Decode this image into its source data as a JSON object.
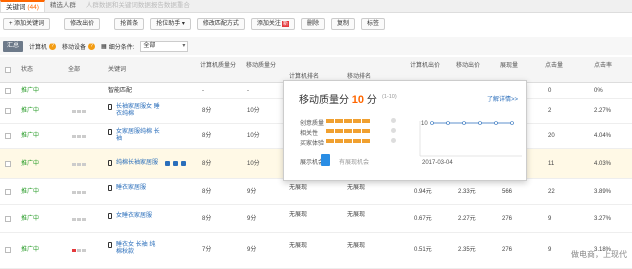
{
  "tabs": [
    {
      "label": "关键词",
      "count": "(44)"
    },
    {
      "label": "精选人群"
    },
    {
      "label": "人群数据和关键词数据报告数据重合"
    }
  ],
  "toolbar": {
    "add_keyword": "+ 添加关键词",
    "modify_bid": "修改出价",
    "raise_rank": "抢首条",
    "bid_assist": "抢位助手",
    "modify_match": "修改匹配方式",
    "add_follow": "添加关注",
    "new_badge": "新",
    "delete": "删除",
    "copy": "复制",
    "tag": "标签"
  },
  "filters": {
    "summary": "汇总",
    "computer": "计算机",
    "mobile": "移动设备",
    "condition_label": "细分条件:",
    "condition_value": "全部"
  },
  "header": {
    "status": "状态",
    "all": "全部",
    "keyword": "关键词",
    "pc_quality": "计算机质量分",
    "mobile_quality": "移动质量分",
    "pc_rank": "计算机排名",
    "mobile_rank": "移动排名",
    "pc_bid": "计算机出价",
    "mobile_bid": "移动出价",
    "impressions": "展现量",
    "clicks": "点击量",
    "ctr": "点击率"
  },
  "rows": [
    {
      "status": "推广中",
      "keyword": "智能匹配",
      "pc_q": "-",
      "m_q": "-",
      "pc_rank": "",
      "m_rank": "",
      "pc_bid": "",
      "m_bid": "",
      "imp": "",
      "clk": "0",
      "ctr": "0%"
    },
    {
      "status": "推广中",
      "keyword": "长袖家居服女 睡衣纯棉",
      "pc_q": "8分",
      "m_q": "10分",
      "pc_rank": "",
      "m_rank": "",
      "pc_bid": "",
      "m_bid": "",
      "imp": "",
      "clk": "2",
      "ctr": "2.27%"
    },
    {
      "status": "推广中",
      "keyword": "女家居服纯棉 长袖",
      "pc_q": "8分",
      "m_q": "10分",
      "pc_rank": "",
      "m_rank": "",
      "pc_bid": "",
      "m_bid": "",
      "imp": "",
      "clk": "20",
      "ctr": "4.04%"
    },
    {
      "status": "推广中",
      "keyword": "纯棉长袖家居服",
      "pc_q": "8分",
      "m_q": "10分",
      "pc_rank": "",
      "m_rank": "",
      "pc_bid": "",
      "m_bid": "",
      "imp": "",
      "clk": "11",
      "ctr": "4.03%"
    },
    {
      "status": "推广中",
      "keyword": "睡衣家居服",
      "pc_q": "8分",
      "m_q": "9分",
      "pc_rank": "无展现",
      "m_rank": "无展现",
      "pc_bid": "0.94元",
      "m_bid": "2.33元",
      "imp": "566",
      "clk": "22",
      "ctr": "3.89%"
    },
    {
      "status": "推广中",
      "keyword": "女睡衣家居服",
      "pc_q": "8分",
      "m_q": "9分",
      "pc_rank": "无展现",
      "m_rank": "无展现",
      "pc_bid": "0.67元",
      "m_bid": "2.27元",
      "imp": "276",
      "clk": "9",
      "ctr": "3.27%"
    },
    {
      "status": "推广中",
      "keyword": "睡衣女 长袖 纯棉秋款",
      "pc_q": "7分",
      "m_q": "9分",
      "pc_rank": "无展现",
      "m_rank": "无展现",
      "pc_bid": "0.51元",
      "m_bid": "2.35元",
      "imp": "276",
      "clk": "9",
      "ctr": "3.18%"
    }
  ],
  "popup": {
    "title": "移动质量分",
    "score": "10",
    "unit": "分",
    "range": "(1-10)",
    "more": "了解详情>>",
    "factors": [
      "创意质量",
      "相关性",
      "买家体验"
    ],
    "device_label": "展示机会",
    "device_hint": "有展现机会",
    "chart_y": "10",
    "chart_x": "2017-03-04"
  },
  "watermark": "做电商，上现代",
  "colors": {
    "accent": "#f60",
    "status_green": "#2a9d2a",
    "link_blue": "#2a6ebb",
    "bar_orange": "#f0a030"
  }
}
